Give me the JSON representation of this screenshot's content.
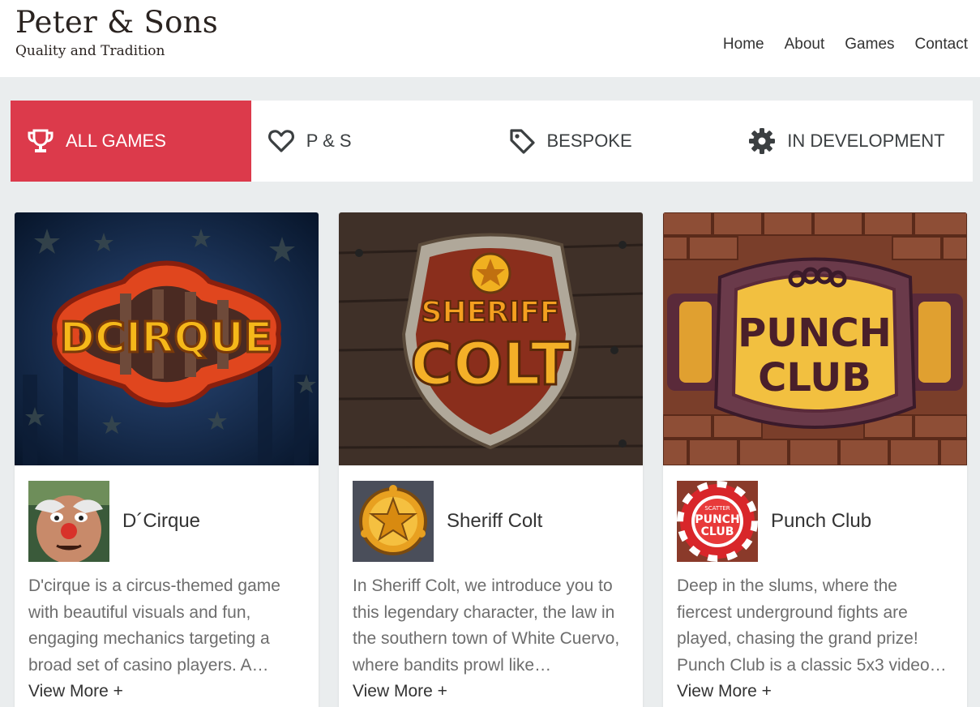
{
  "brand": {
    "title": "Peter & Sons",
    "tagline": "Quality and Tradition"
  },
  "nav": {
    "items": [
      "Home",
      "About",
      "Games",
      "Contact"
    ]
  },
  "filters": [
    {
      "label": "ALL GAMES",
      "icon": "trophy-icon",
      "active": true
    },
    {
      "label": "P & S",
      "icon": "heart-icon",
      "active": false
    },
    {
      "label": "BESPOKE",
      "icon": "tag-icon",
      "active": false
    },
    {
      "label": "IN DEVELOPMENT",
      "icon": "gear-icon",
      "active": false
    }
  ],
  "colors": {
    "accent": "#dc3a4b",
    "background": "#eaedee",
    "text": "#333333"
  },
  "games": [
    {
      "title": "D´Cirque",
      "image_text": "DCIRQUE",
      "description": "D'cirque is a circus-themed game with beautiful visuals and fun, engaging mechanics targeting a broad set of casino players. A…",
      "link": "View More +"
    },
    {
      "title": "Sheriff Colt",
      "image_text": [
        "SHERIFF",
        "COLT"
      ],
      "description": "In Sheriff Colt, we introduce you to this legendary character, the law in the southern town of White Cuervo, where bandits prowl like…",
      "link": "View More +"
    },
    {
      "title": "Punch Club",
      "image_text": [
        "PUNCH",
        "CLUB"
      ],
      "thumb_text": [
        "SCATTER",
        "PUNCH",
        "CLUB"
      ],
      "description": "Deep in the slums, where the fiercest underground fights are played, chasing the grand prize! Punch Club is a classic 5x3 video…",
      "link": "View More +"
    }
  ]
}
